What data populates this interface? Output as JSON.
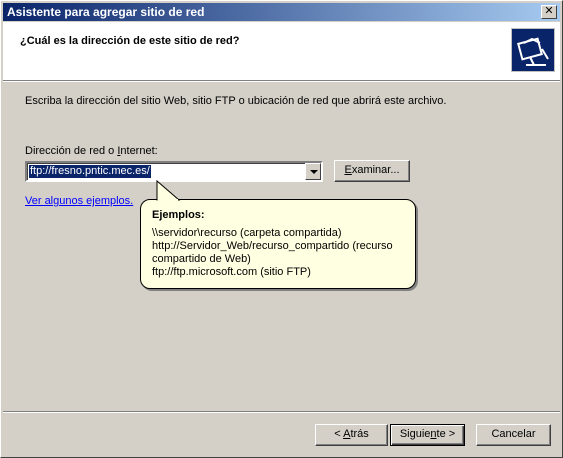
{
  "window": {
    "title": "Asistente para agregar sitio de red",
    "close_glyph": "✕"
  },
  "header": {
    "title": "¿Cuál es la dirección de este sitio de red?",
    "icon": "network-place-icon"
  },
  "body": {
    "intro": "Escriba la dirección del sitio Web, sitio FTP o ubicación de red que abrirá este archivo.",
    "address_label_pre": "Dirección de red o ",
    "address_label_acc": "I",
    "address_label_post": "nternet:",
    "address_value": "ftp://fresno.pntic.mec.es/",
    "browse_acc": "E",
    "browse_rest": "xaminar...",
    "examples_link": "Ver algunos ejemplos."
  },
  "balloon": {
    "title": "Ejemplos:",
    "line1": "\\\\servidor\\recurso   (carpeta compartida)",
    "line2": "http://Servidor_Web/recurso_compartido   (recurso compartido de Web)",
    "line3": "ftp://ftp.microsoft.com   (sitio FTP)"
  },
  "footer": {
    "back_pre": "< ",
    "back_acc": "A",
    "back_post": "trás",
    "next_pre": "Siguie",
    "next_acc": "n",
    "next_post": "te >",
    "cancel": "Cancelar"
  },
  "colors": {
    "title_bar_start": "#0a246a",
    "title_bar_end": "#a6caf0",
    "dialog_face": "#d4d0c8",
    "balloon_bg": "#ffffe1",
    "link": "#0000ff"
  }
}
